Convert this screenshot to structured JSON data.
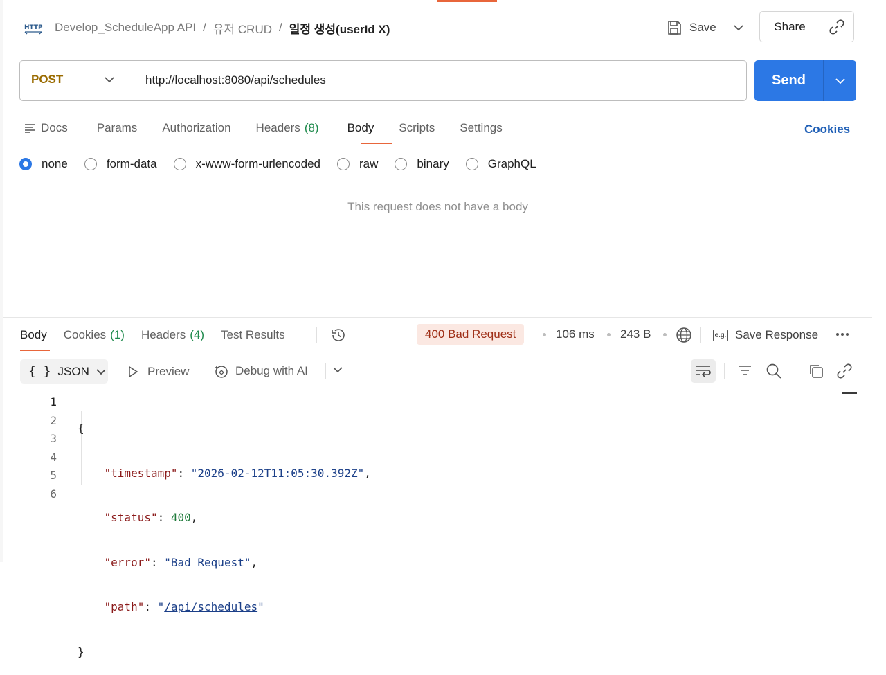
{
  "header": {
    "breadcrumb": [
      "Develop_ScheduleApp API",
      "유저 CRUD",
      "일정 생성(userId X)"
    ],
    "breadcrumb_sep": "/",
    "save_label": "Save",
    "share_label": "Share"
  },
  "request": {
    "method": "POST",
    "url": "http://localhost:8080/api/schedules",
    "send_label": "Send",
    "tabs": [
      {
        "label": "Docs",
        "count": ""
      },
      {
        "label": "Params",
        "count": ""
      },
      {
        "label": "Authorization",
        "count": ""
      },
      {
        "label": "Headers",
        "count": "(8)"
      },
      {
        "label": "Body",
        "count": ""
      },
      {
        "label": "Scripts",
        "count": ""
      },
      {
        "label": "Settings",
        "count": ""
      }
    ],
    "cookies_label": "Cookies",
    "body_types": [
      "none",
      "form-data",
      "x-www-form-urlencoded",
      "raw",
      "binary",
      "GraphQL"
    ],
    "selected_body_type": "none",
    "no_body_message": "This request does not have a body"
  },
  "response": {
    "tabs": [
      {
        "label": "Body",
        "count": ""
      },
      {
        "label": "Cookies",
        "count": "(1)"
      },
      {
        "label": "Headers",
        "count": "(4)"
      },
      {
        "label": "Test Results",
        "count": ""
      }
    ],
    "status": "400 Bad Request",
    "time": "106 ms",
    "size": "243 B",
    "save_response_label": "Save Response",
    "eg_label": "e.g.",
    "format": "JSON",
    "format_braces": "{ }",
    "preview_label": "Preview",
    "debug_label": "Debug with AI",
    "line_numbers": [
      "1",
      "2",
      "3",
      "4",
      "5",
      "6"
    ],
    "json": {
      "timestamp": "2026-02-12T11:05:30.392Z",
      "status": "400",
      "error": "Bad Request",
      "path": "/api/schedules"
    }
  },
  "colors": {
    "accent": "#e8663b",
    "send": "#2c78e5",
    "status_bg": "#fbe8e2",
    "status_text": "#9f2f17"
  }
}
